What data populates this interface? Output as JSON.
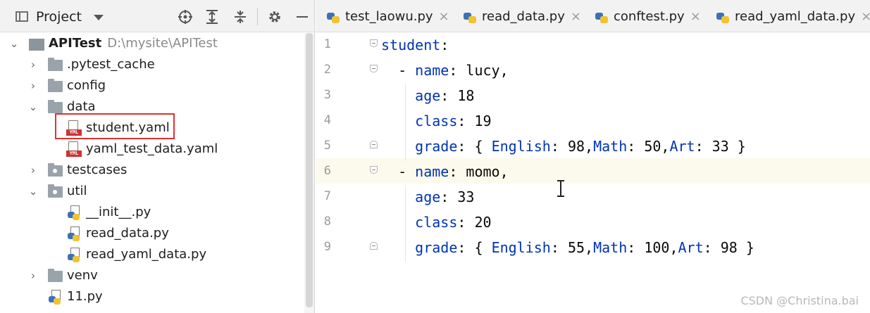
{
  "project_panel": {
    "title": "Project",
    "tree": [
      {
        "label": "APITest",
        "sub": "D:\\mysite\\APITest",
        "kind": "root",
        "expanded": true
      },
      {
        "label": ".pytest_cache",
        "kind": "folder",
        "expanded": false
      },
      {
        "label": "config",
        "kind": "folder",
        "expanded": false
      },
      {
        "label": "data",
        "kind": "folder",
        "expanded": true
      },
      {
        "label": "student.yaml",
        "kind": "yaml",
        "selected": true
      },
      {
        "label": "yaml_test_data.yaml",
        "kind": "yaml"
      },
      {
        "label": "testcases",
        "kind": "package",
        "expanded": false
      },
      {
        "label": "util",
        "kind": "package",
        "expanded": true
      },
      {
        "label": "__init__.py",
        "kind": "py"
      },
      {
        "label": "read_data.py",
        "kind": "py"
      },
      {
        "label": "read_yaml_data.py",
        "kind": "py"
      },
      {
        "label": "venv",
        "kind": "folder",
        "expanded": false
      },
      {
        "label": "11.py",
        "kind": "py"
      }
    ],
    "yml_badge": "YML"
  },
  "editor": {
    "tabs": [
      {
        "label": "test_laowu.py"
      },
      {
        "label": "read_data.py"
      },
      {
        "label": "conftest.py"
      },
      {
        "label": "read_yaml_data.py"
      }
    ],
    "line_numbers": [
      "1",
      "2",
      "3",
      "4",
      "5",
      "6",
      "7",
      "8",
      "9"
    ],
    "lines": [
      {
        "pre": "",
        "key": "student",
        "rest": ":"
      },
      {
        "pre": "  - ",
        "key": "name",
        "rest": ": lucy,"
      },
      {
        "pre": "    ",
        "key": "age",
        "rest": ": 18"
      },
      {
        "pre": "    ",
        "key": "class",
        "rest": ": 19"
      },
      {
        "pre": "    ",
        "key": "grade",
        "rest": ": { ",
        "k2": "English",
        "r2": ": 98,",
        "k3": "Math",
        "r3": ": 50,",
        "k4": "Art",
        "r4": ": 33 }"
      },
      {
        "pre": "  - ",
        "key": "name",
        "rest": ": momo,"
      },
      {
        "pre": "    ",
        "key": "age",
        "rest": ": 33"
      },
      {
        "pre": "    ",
        "key": "class",
        "rest": ": 20"
      },
      {
        "pre": "    ",
        "key": "grade",
        "rest": ": { ",
        "k2": "English",
        "r2": ": 55,",
        "k3": "Math",
        "r3": ": 100,",
        "k4": "Art",
        "r4": ": 98 }"
      }
    ],
    "current_line": "6"
  },
  "colors": {
    "keyword": "#0033b3",
    "highlight_box": "#e0312f",
    "current_line_bg": "#fcfaed"
  },
  "watermark": "CSDN @Christina.bai"
}
